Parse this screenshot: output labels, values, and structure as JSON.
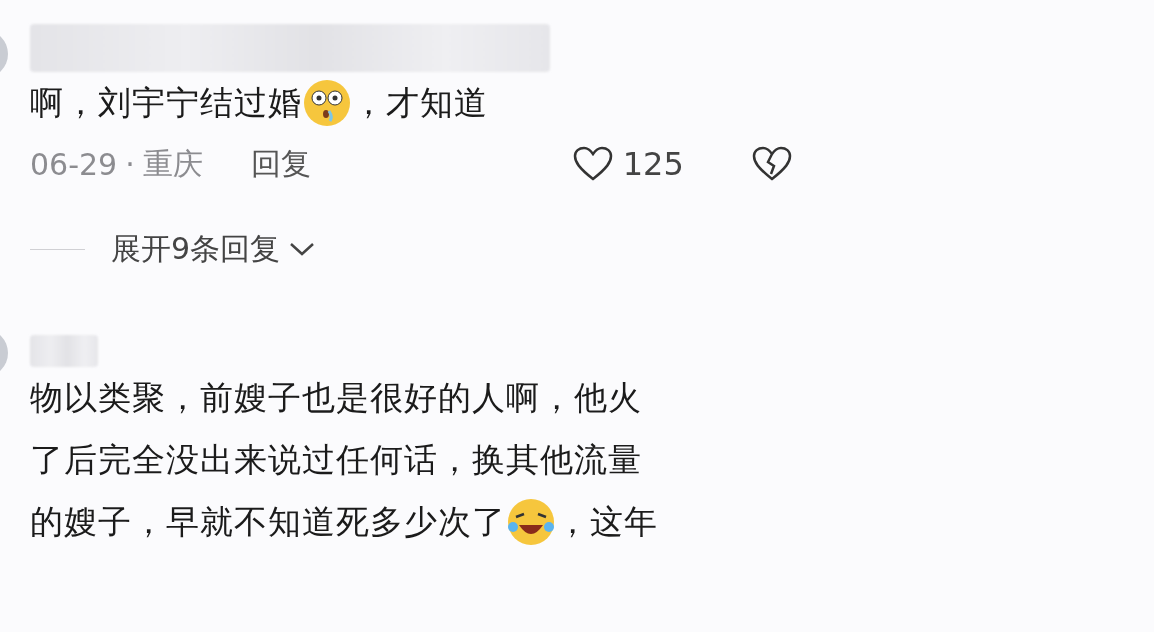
{
  "comments": [
    {
      "lines": [
        [
          {
            "kind": "text",
            "text": "啊，刘宇宁结过婚"
          },
          {
            "kind": "drool"
          },
          {
            "kind": "text",
            "text": "，才知道"
          }
        ]
      ],
      "date": "06-29",
      "separator": "·",
      "location": "重庆",
      "reply": "回复",
      "likes": "125",
      "liked": false,
      "expand": "展开9条回复"
    },
    {
      "lines": [
        [
          {
            "kind": "text",
            "text": "物以类聚，前嫂子也是很好的人啊，他火"
          }
        ],
        [
          {
            "kind": "text",
            "text": "了后完全没出来说过任何话，换其他流量"
          }
        ],
        [
          {
            "kind": "text",
            "text": "的嫂子，早就不知道死多少次了"
          },
          {
            "kind": "laugh"
          },
          {
            "kind": "text",
            "text": "，这年"
          }
        ]
      ]
    }
  ]
}
